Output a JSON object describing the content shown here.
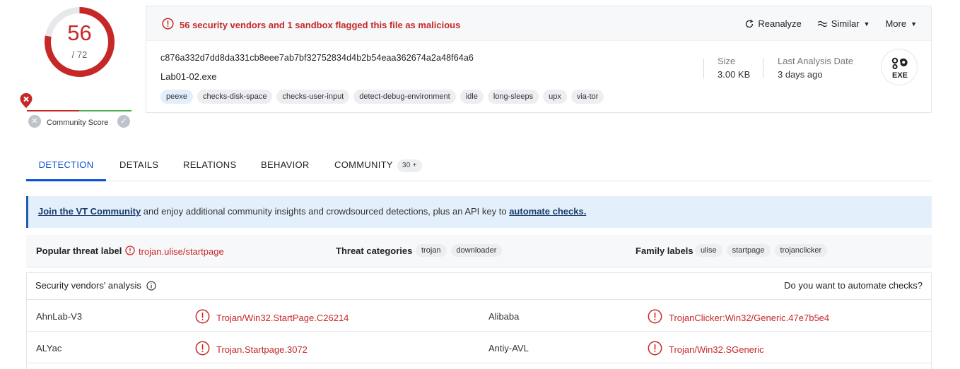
{
  "score": {
    "detected": "56",
    "total": "/ 72",
    "ratio": 0.7778,
    "ring_color": "#c62828",
    "community_label": "Community Score",
    "community_icon": "map-pin-x-icon"
  },
  "header": {
    "alert_text": "56 security vendors and 1 sandbox flagged this file as malicious",
    "alert_icon": "alert-circle-icon",
    "actions": {
      "reanalyze": "Reanalyze",
      "similar": "Similar",
      "more": "More"
    }
  },
  "file": {
    "hash": "c876a332d7dd8da331cb8eee7ab7bf32752834d4b2b54eaa362674a2a48f64a6",
    "name": "Lab01-02.exe",
    "tags": [
      "peexe",
      "checks-disk-space",
      "checks-user-input",
      "detect-debug-environment",
      "idle",
      "long-sleeps",
      "upx",
      "via-tor"
    ],
    "size_label": "Size",
    "size_value": "3.00 KB",
    "last_analysis_label": "Last Analysis Date",
    "last_analysis_value": "3 days ago",
    "type_badge": "EXE"
  },
  "tabs": {
    "detection": "DETECTION",
    "details": "DETAILS",
    "relations": "RELATIONS",
    "behavior": "BEHAVIOR",
    "community": "COMMUNITY",
    "community_count": "30 +",
    "active": "detection"
  },
  "banner": {
    "link1": "Join the VT Community",
    "middle": " and enjoy additional community insights and crowdsourced detections, plus an API key to ",
    "link2": "automate checks."
  },
  "threat": {
    "popular_label": "Popular threat label",
    "popular_value": "trojan.ulise/startpage",
    "categories_label": "Threat categories",
    "categories": [
      "trojan",
      "downloader"
    ],
    "family_label": "Family labels",
    "families": [
      "ulise",
      "startpage",
      "trojanclicker"
    ]
  },
  "vendors": {
    "title": "Security vendors' analysis",
    "cta": "Do you want to automate checks?",
    "rows": [
      {
        "left_name": "AhnLab-V3",
        "left_result": "Trojan/Win32.StartPage.C26214",
        "right_name": "Alibaba",
        "right_result": "TrojanClicker:Win32/Generic.47e7b5e4"
      },
      {
        "left_name": "ALYac",
        "left_result": "Trojan.Startpage.3072",
        "right_name": "Antiy-AVL",
        "right_result": "Trojan/Win32.SGeneric"
      }
    ]
  },
  "colors": {
    "malicious": "#c62828",
    "accent": "#0b4dda",
    "banner_bg": "#e3f0fb"
  }
}
